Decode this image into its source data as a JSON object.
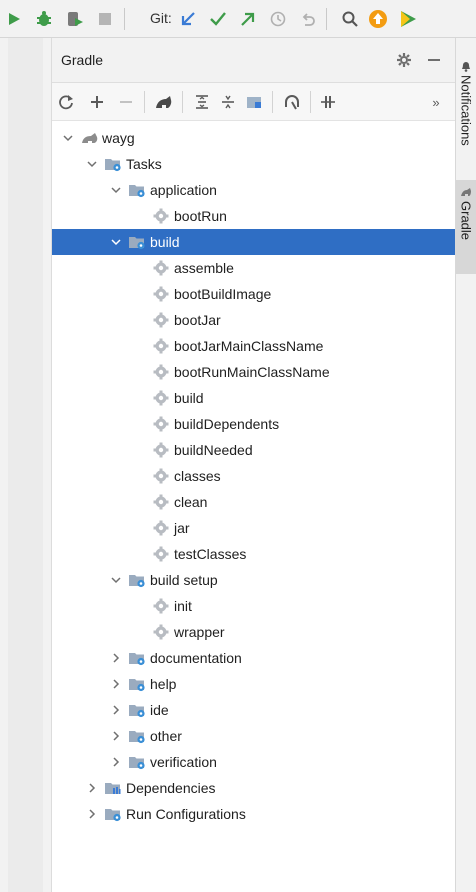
{
  "toolbar": {
    "git_label": "Git:"
  },
  "panel": {
    "title": "Gradle",
    "overflow": "»"
  },
  "tree": [
    {
      "label": "wayg",
      "depth": 0,
      "expander": "open",
      "icon": "gradle-elephant"
    },
    {
      "label": "Tasks",
      "depth": 1,
      "expander": "open",
      "icon": "task-folder"
    },
    {
      "label": "application",
      "depth": 2,
      "expander": "open",
      "icon": "task-folder"
    },
    {
      "label": "bootRun",
      "depth": 3,
      "expander": "none",
      "icon": "gear"
    },
    {
      "label": "build",
      "depth": 2,
      "expander": "open",
      "icon": "task-folder",
      "selected": true
    },
    {
      "label": "assemble",
      "depth": 3,
      "expander": "none",
      "icon": "gear"
    },
    {
      "label": "bootBuildImage",
      "depth": 3,
      "expander": "none",
      "icon": "gear"
    },
    {
      "label": "bootJar",
      "depth": 3,
      "expander": "none",
      "icon": "gear"
    },
    {
      "label": "bootJarMainClassName",
      "depth": 3,
      "expander": "none",
      "icon": "gear"
    },
    {
      "label": "bootRunMainClassName",
      "depth": 3,
      "expander": "none",
      "icon": "gear"
    },
    {
      "label": "build",
      "depth": 3,
      "expander": "none",
      "icon": "gear"
    },
    {
      "label": "buildDependents",
      "depth": 3,
      "expander": "none",
      "icon": "gear"
    },
    {
      "label": "buildNeeded",
      "depth": 3,
      "expander": "none",
      "icon": "gear"
    },
    {
      "label": "classes",
      "depth": 3,
      "expander": "none",
      "icon": "gear"
    },
    {
      "label": "clean",
      "depth": 3,
      "expander": "none",
      "icon": "gear"
    },
    {
      "label": "jar",
      "depth": 3,
      "expander": "none",
      "icon": "gear"
    },
    {
      "label": "testClasses",
      "depth": 3,
      "expander": "none",
      "icon": "gear"
    },
    {
      "label": "build setup",
      "depth": 2,
      "expander": "open",
      "icon": "task-folder"
    },
    {
      "label": "init",
      "depth": 3,
      "expander": "none",
      "icon": "gear"
    },
    {
      "label": "wrapper",
      "depth": 3,
      "expander": "none",
      "icon": "gear"
    },
    {
      "label": "documentation",
      "depth": 2,
      "expander": "closed",
      "icon": "task-folder"
    },
    {
      "label": "help",
      "depth": 2,
      "expander": "closed",
      "icon": "task-folder"
    },
    {
      "label": "ide",
      "depth": 2,
      "expander": "closed",
      "icon": "task-folder"
    },
    {
      "label": "other",
      "depth": 2,
      "expander": "closed",
      "icon": "task-folder"
    },
    {
      "label": "verification",
      "depth": 2,
      "expander": "closed",
      "icon": "task-folder"
    },
    {
      "label": "Dependencies",
      "depth": 1,
      "expander": "closed",
      "icon": "deps-folder"
    },
    {
      "label": "Run Configurations",
      "depth": 1,
      "expander": "closed",
      "icon": "task-folder"
    }
  ],
  "right_tabs": {
    "notifications": "Notifications",
    "gradle": "Gradle"
  },
  "colors": {
    "selection": "#2f6ec4",
    "run_green": "#3f9c4a",
    "git_blue": "#3a7bd5",
    "git_green": "#3f9c4a"
  }
}
